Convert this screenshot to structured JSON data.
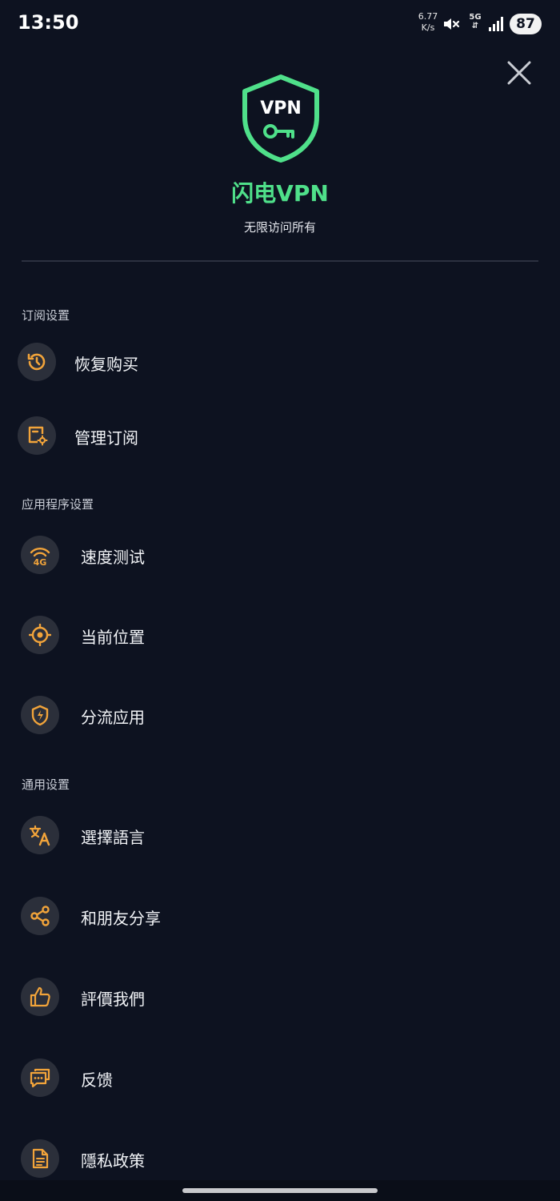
{
  "status_bar": {
    "time": "13:50",
    "net_speed_value": "6.77",
    "net_speed_unit": "K/s",
    "network_type": "5G",
    "battery": "87"
  },
  "header": {
    "logo_text": "VPN",
    "app_name": "闪电VPN",
    "tagline": "无限访问所有"
  },
  "colors": {
    "accent_green": "#4fe08a",
    "icon_amber": "#f2a43a",
    "background": "#0d1220"
  },
  "sections": {
    "subscription": {
      "title": "订阅设置",
      "items": [
        {
          "label": "恢复购买",
          "icon": "restore-history-icon"
        },
        {
          "label": "管理订阅",
          "icon": "manage-subscription-icon"
        }
      ]
    },
    "app": {
      "title": "应用程序设置",
      "items": [
        {
          "label": "速度测试",
          "icon": "speed-test-4g-icon"
        },
        {
          "label": "当前位置",
          "icon": "location-target-icon"
        },
        {
          "label": "分流应用",
          "icon": "shield-bolt-icon"
        }
      ]
    },
    "general": {
      "title": "通用设置",
      "items": [
        {
          "label": "選擇語言",
          "icon": "translate-icon"
        },
        {
          "label": "和朋友分享",
          "icon": "share-icon"
        },
        {
          "label": "評價我們",
          "icon": "thumbs-up-icon"
        },
        {
          "label": "反馈",
          "icon": "chat-feedback-icon"
        },
        {
          "label": "隱私政策",
          "icon": "document-icon"
        }
      ]
    }
  }
}
